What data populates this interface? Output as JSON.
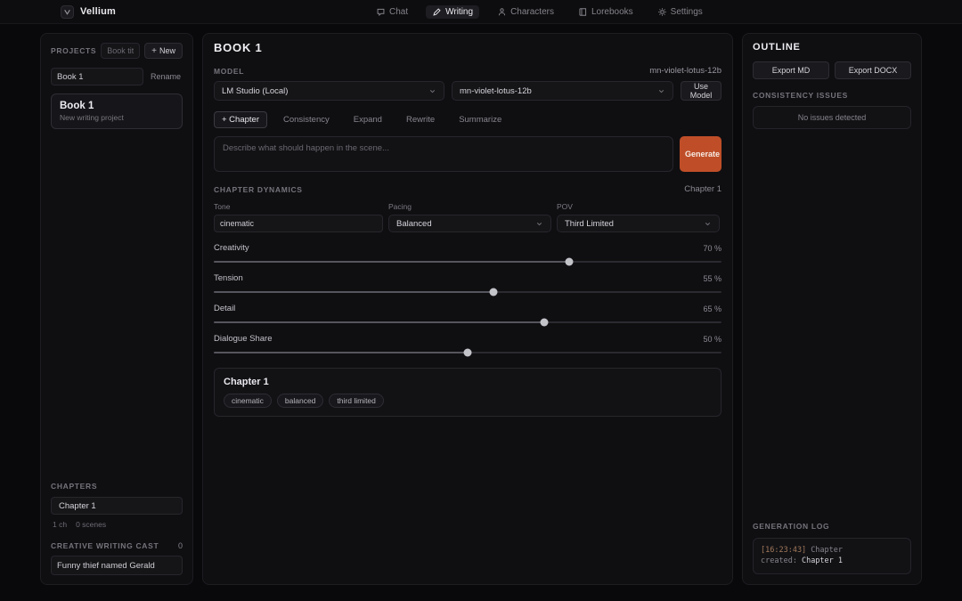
{
  "app": {
    "brand": "Vellium",
    "nav": [
      {
        "label": "Chat",
        "icon": "chat-icon"
      },
      {
        "label": "Writing",
        "icon": "pencil-icon"
      },
      {
        "label": "Characters",
        "icon": "person-icon"
      },
      {
        "label": "Lorebooks",
        "icon": "book-icon"
      },
      {
        "label": "Settings",
        "icon": "gear-icon"
      }
    ]
  },
  "sidebar": {
    "projects": {
      "title": "Projects",
      "title_placeholder": "Book title",
      "new_button": "New",
      "project_name": "Book 1",
      "rename_button": "Rename",
      "card": {
        "title": "Book 1",
        "subtitle": "New writing project"
      }
    },
    "chapters": {
      "title": "Chapters",
      "items": [
        {
          "label": "Chapter 1"
        }
      ],
      "chapter_count": "1 ch",
      "scene_count": "0 scenes"
    },
    "cast": {
      "title": "Creative Writing Cast",
      "count": "0",
      "entry": "Funny thief named Gerald"
    }
  },
  "main": {
    "title": "Book 1",
    "model": {
      "label": "Model",
      "active_model": "mn-violet-lotus-12b",
      "provider": "LM Studio (Local)",
      "model_name": "mn-violet-lotus-12b",
      "use_button": "Use Model"
    },
    "tabs": [
      {
        "label": "+ Chapter"
      },
      {
        "label": "Consistency"
      },
      {
        "label": "Expand"
      },
      {
        "label": "Rewrite"
      },
      {
        "label": "Summarize"
      }
    ],
    "prompt": {
      "placeholder": "Describe what should happen in the scene...",
      "generate_button": "Generate"
    },
    "dynamics": {
      "title": "Chapter Dynamics",
      "chapter_ref": "Chapter 1",
      "tone_label": "Tone",
      "tone_value": "cinematic",
      "pacing_label": "Pacing",
      "pacing_value": "Balanced",
      "pov_label": "POV",
      "pov_value": "Third Limited",
      "sliders": [
        {
          "label": "Creativity",
          "value": 70,
          "display": "70 %"
        },
        {
          "label": "Tension",
          "value": 55,
          "display": "55 %"
        },
        {
          "label": "Detail",
          "value": 65,
          "display": "65 %"
        },
        {
          "label": "Dialogue Share",
          "value": 50,
          "display": "50 %"
        }
      ]
    },
    "chapter_card": {
      "title": "Chapter 1",
      "tags": [
        "cinematic",
        "balanced",
        "third limited"
      ]
    }
  },
  "outline": {
    "title": "Outline",
    "export_md_button": "Export MD",
    "export_docx_button": "Export DOCX",
    "consistency_title": "Consistency Issues",
    "consistency_status": "No issues detected"
  },
  "log": {
    "title": "Generation Log",
    "entries": [
      {
        "time": "[16:23:43]",
        "message": "Chapter created:",
        "target": "Chapter 1"
      }
    ]
  },
  "colors": {
    "accent": "#bf4e28"
  }
}
